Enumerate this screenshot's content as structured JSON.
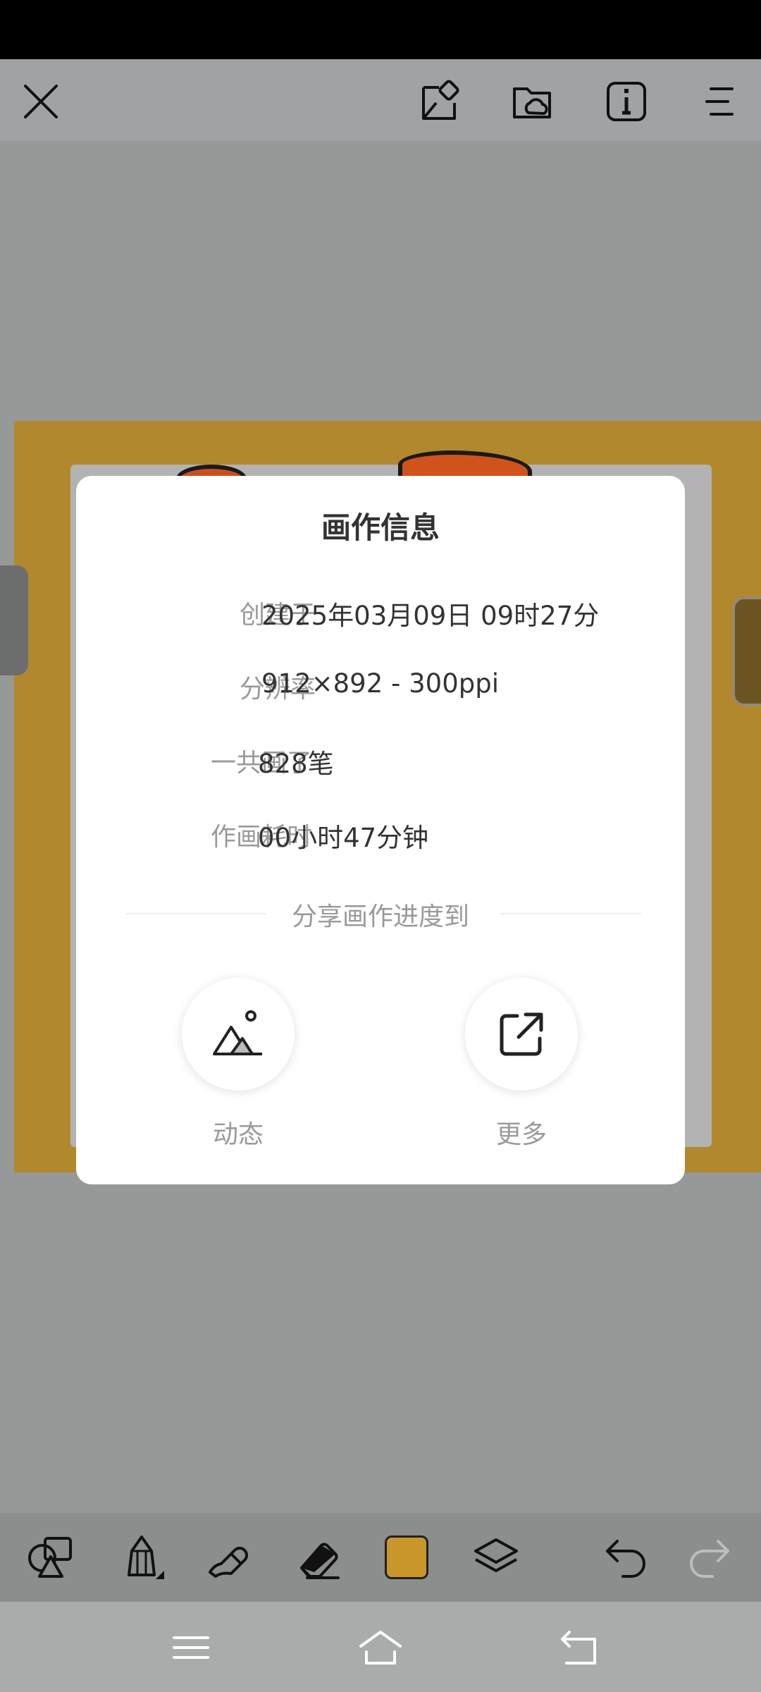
{
  "top_bar": {
    "icons": [
      "close-icon",
      "edit-file-icon",
      "cloud-folder-icon",
      "info-icon",
      "menu-icon"
    ]
  },
  "dialog": {
    "title": "画作信息",
    "rows": [
      {
        "label": "创建于",
        "value": "2025年03月09日 09时27分"
      },
      {
        "label": "分辨率",
        "value": "912×892 - 300ppi"
      },
      {
        "label": "一共画了",
        "value": "828笔"
      },
      {
        "label": "作画耗时",
        "value": "00小时47分钟"
      }
    ],
    "share_title": "分享画作进度到",
    "share_buttons": [
      {
        "label": "动态",
        "icon": "mountain-image-icon"
      },
      {
        "label": "更多",
        "icon": "external-share-icon"
      }
    ]
  },
  "bottom_toolbar": {
    "tools": [
      "shapes-icon",
      "pencil-icon",
      "smudge-icon",
      "eraser-icon",
      "color-swatch",
      "layers-icon",
      "undo-icon",
      "redo-icon"
    ],
    "current_color": "#c8962b"
  },
  "nav_bar": {
    "icons": [
      "recents-icon",
      "home-icon",
      "back-icon"
    ]
  }
}
